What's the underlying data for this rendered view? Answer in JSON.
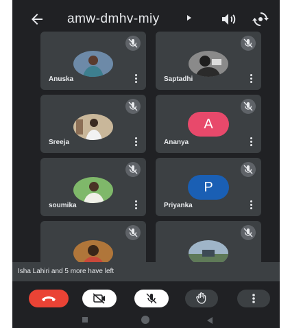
{
  "header": {
    "meeting_code": "amw-dmhv-miy",
    "back_icon": "arrow-left-icon",
    "speaker_icon": "speaker-icon",
    "switch_camera_icon": "switch-camera-icon"
  },
  "participants": [
    {
      "name": "Anuska",
      "avatar": "photo",
      "muted": true
    },
    {
      "name": "Saptadhi",
      "avatar": "photo",
      "muted": true
    },
    {
      "name": "Sreeja",
      "avatar": "photo",
      "muted": true
    },
    {
      "name": "Ananya",
      "avatar": "letter",
      "letter": "A",
      "avatar_color": "#e8496b",
      "muted": true
    },
    {
      "name": "soumika",
      "avatar": "photo",
      "muted": true
    },
    {
      "name": "Priyanka",
      "avatar": "letter",
      "letter": "P",
      "avatar_color": "#1a5fb4",
      "muted": true
    },
    {
      "name": "",
      "avatar": "photo",
      "muted": true
    },
    {
      "name": "",
      "avatar": "photo",
      "muted": true
    }
  ],
  "notification": {
    "text": "Isha Lahiri and 5 more have left"
  },
  "controls": {
    "end_call_icon": "end-call-icon",
    "camera_off_icon": "camera-off-icon",
    "mic_off_icon": "mic-off-icon",
    "raise_hand_icon": "raise-hand-icon",
    "more_options_icon": "more-options-icon"
  },
  "colors": {
    "background": "#202124",
    "tile": "#3c4043",
    "end_call": "#ea4335",
    "text": "#e8eaed"
  }
}
